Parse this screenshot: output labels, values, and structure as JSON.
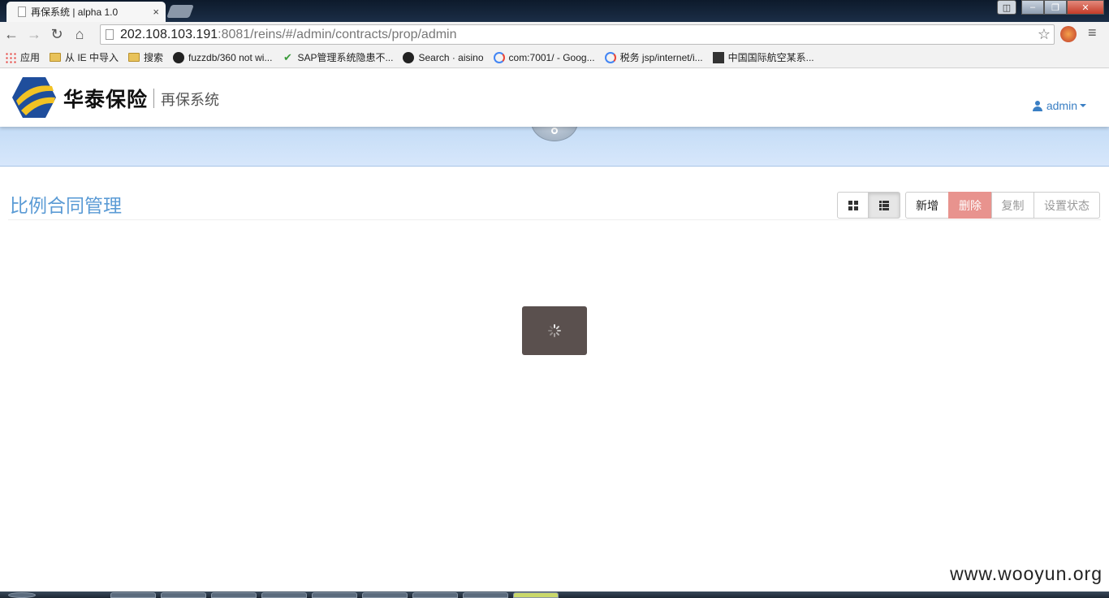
{
  "browser": {
    "tab_title": "再保系统 | alpha 1.0",
    "tab_close": "×",
    "url_host": "202.108.103.191",
    "url_path": ":8081/reins/#/admin/contracts/prop/admin",
    "nav_back": "←",
    "nav_forward": "→",
    "nav_reload": "↻",
    "nav_home": "⌂",
    "star": "☆",
    "menu": "≡",
    "bookmarks": [
      {
        "label": "应用",
        "icon": "apps-icon"
      },
      {
        "label": "从 IE 中导入",
        "icon": "folder-icon"
      },
      {
        "label": "搜索",
        "icon": "folder-icon"
      },
      {
        "label": "fuzzdb/360 not wi...",
        "icon": "github-icon"
      },
      {
        "label": "SAP管理系统隐患不...",
        "icon": "check-icon"
      },
      {
        "label": "Search · aisino",
        "icon": "github-icon"
      },
      {
        "label": "com:7001/ - Goog...",
        "icon": "google-icon"
      },
      {
        "label": "税务 jsp/internet/i...",
        "icon": "google-icon"
      },
      {
        "label": "中国国际航空某系...",
        "icon": "site-icon"
      }
    ]
  },
  "header": {
    "logo_text": "华泰保险",
    "system_name": "再保系统",
    "user_name": "admin",
    "logo_colors": {
      "blue": "#1f4e9c",
      "yellow": "#f2c224"
    }
  },
  "page": {
    "title": "比例合同管理",
    "actions": {
      "add": "新增",
      "delete": "删除",
      "copy": "复制",
      "set_status": "设置状态"
    }
  },
  "watermark": "www.wooyun.org",
  "colors": {
    "title_blue": "#5b9bd5",
    "delete_red": "#e8938e",
    "loading_bg": "#5a504e"
  }
}
